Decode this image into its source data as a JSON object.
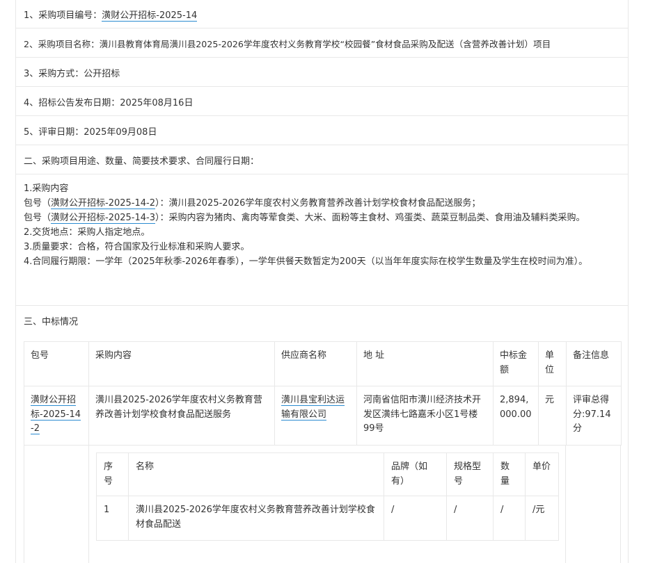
{
  "info": {
    "item1_label": "1、采购项目编号：",
    "item1_value": "潢财公开招标-2025-14",
    "item2": "2、采购项目名称：潢川县教育体育局潢川县2025-2026学年度农村义务教育学校“校园餐”食材食品采购及配送（含营养改善计划）项目",
    "item3": "3、采购方式：公开招标",
    "item4": "4、招标公告发布日期：2025年08月16日",
    "item5": "5、评审日期：2025年09月08日"
  },
  "section2": {
    "heading": "二、采购项目用途、数量、简要技术要求、合同履行日期：",
    "line1": "1.采购内容",
    "pkg1_prefix": "包号（",
    "pkg1_code": "潢财公开招标-2025-14-2",
    "pkg1_suffix": "）：潢川县2025-2026学年度农村义务教育营养改善计划学校食材食品配送服务；",
    "pkg2_prefix": "包号（",
    "pkg2_code": "潢财公开招标-2025-14-3",
    "pkg2_suffix": "）：采购内容为猪肉、禽肉等荤食类、大米、面粉等主食材、鸡蛋类、蔬菜豆制品类、食用油及辅料类采购。",
    "line2": "2.交货地点：采购人指定地点。",
    "line3": "3.质量要求：合格，符合国家及行业标准和采购人要求。",
    "line4": "4.合同履行期限：一学年（2025年秋季-2026年春季），一学年供餐天数暂定为200天（以当年年度实际在校学生数量及学生在校时间为准）。"
  },
  "section3": {
    "heading": "三、中标情况"
  },
  "award_table": {
    "headers": [
      "包号",
      "采购内容",
      "供应商名称",
      "地 址",
      "中标金额",
      "单位",
      "备注信息"
    ],
    "row": {
      "package": "潢财公开招标-2025-14-2",
      "content": "潢川县2025-2026学年度农村义务教育营养改善计划学校食材食品配送服务",
      "supplier": "潢川县宝利达运输有限公司",
      "address": "河南省信阳市潢川经济技术开发区潢纬七路嘉禾小区1号楼99号",
      "amount": "2,894,000.00",
      "unit": "元",
      "remark": "评审总得分:97.14分"
    }
  },
  "item_table": {
    "headers": [
      "序号",
      "名称",
      "品牌（如有）",
      "规格型号",
      "数量",
      "单价"
    ],
    "row": {
      "no": "1",
      "name": "潢川县2025-2026学年度农村义务教育营养改善计划学校食材食品配送",
      "brand": "/",
      "spec": "/",
      "qty": "/",
      "price": "/元"
    }
  }
}
